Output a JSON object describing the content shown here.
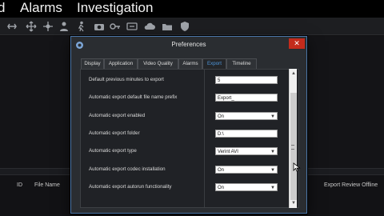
{
  "menu": [
    "d",
    "Alarms",
    "Investigation"
  ],
  "toolbar": {
    "icons": [
      "link-icon",
      "move-icon",
      "move-icon",
      "person-icon",
      "walk-icon",
      "camera-icon",
      "key-icon",
      "dvr-icon",
      "cloud-icon",
      "folder-icon",
      "shield-icon"
    ]
  },
  "dialog": {
    "title": "Preferences",
    "tabs": [
      "Display",
      "Application",
      "Video Quality",
      "Alarms",
      "Export",
      "Timeline"
    ],
    "active_tab": "Export",
    "rows": [
      {
        "label": "Default previous minutes to export",
        "value": "5",
        "type": "text"
      },
      {
        "label": "Automatic export default file name prefix",
        "value": "Export_",
        "type": "text"
      },
      {
        "label": "Automatic export enabled",
        "value": "On",
        "type": "select"
      },
      {
        "label": "Automatic export folder",
        "value": "D:\\",
        "type": "text"
      },
      {
        "label": "Automatic export type",
        "value": "Verint AVI",
        "type": "select"
      },
      {
        "label": "Automatic export codec installation",
        "value": "On",
        "type": "select"
      },
      {
        "label": "Automatic export autorun functionality",
        "value": "On",
        "type": "select"
      }
    ]
  },
  "grid": {
    "columns": [
      "ID",
      "File Name",
      "Export Review Offline"
    ]
  },
  "colors": {
    "accent": "#4e96db",
    "close": "#c42b1c",
    "dialog_border": "#4b76a8"
  }
}
